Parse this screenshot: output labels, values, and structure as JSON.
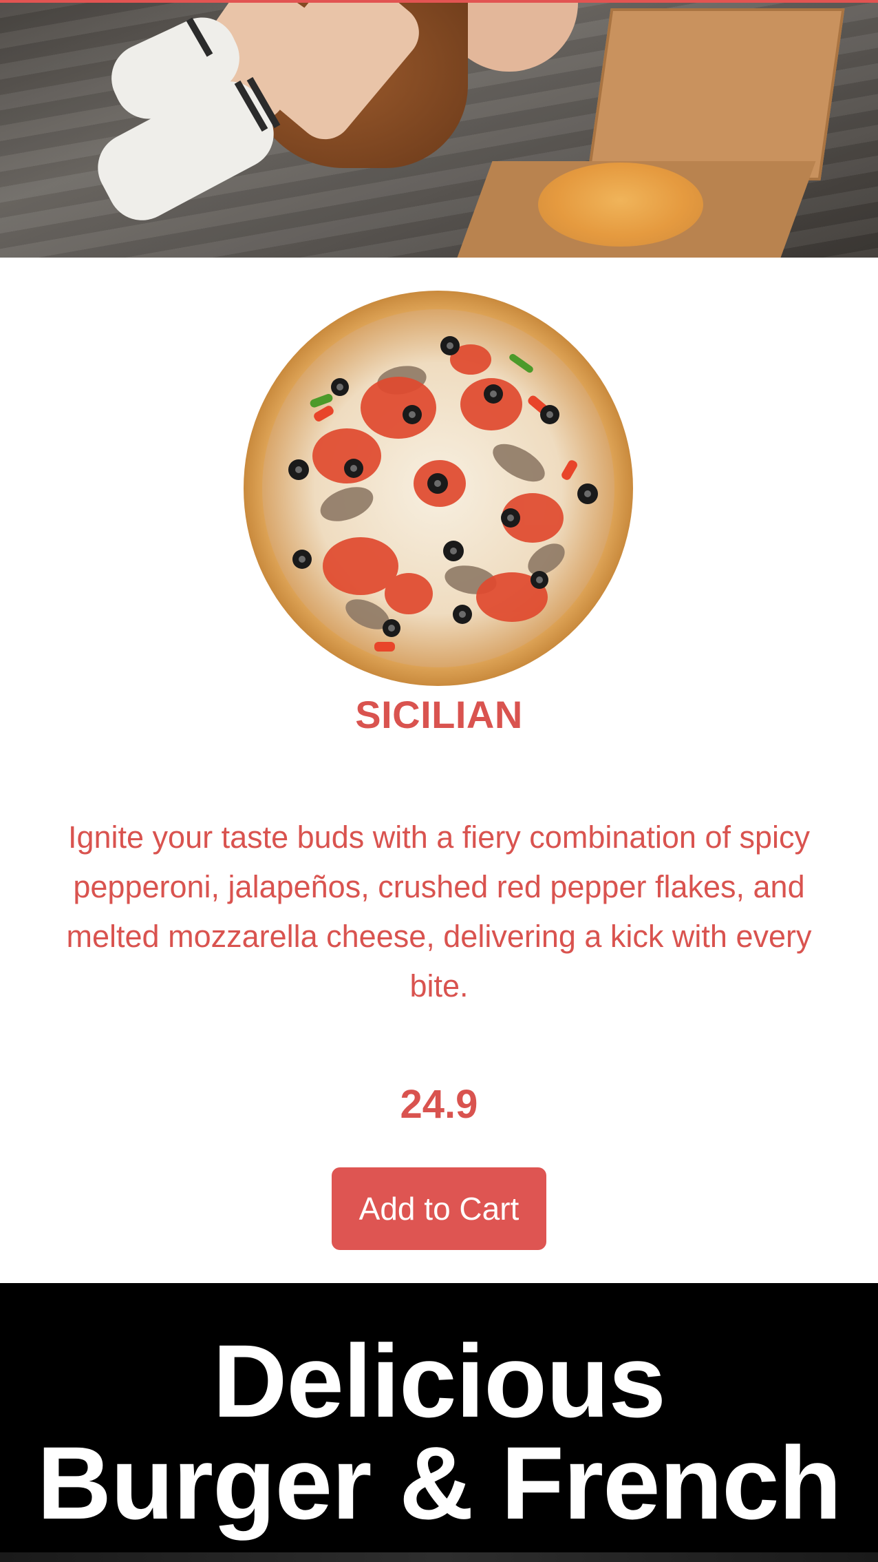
{
  "product": {
    "name": "SICILIAN",
    "description": "Ignite your taste buds with a fiery combination of spicy pepperoni, jalapeños, crushed red pepper flakes, and melted mozzarella cheese, delivering a kick with every bite.",
    "price": "24.9",
    "add_to_cart_label": "Add to Cart"
  },
  "banner": {
    "line1": "Delicious",
    "line2": "Burger & French"
  },
  "colors": {
    "accent": "#d9534f",
    "button": "#de5552",
    "banner_bg": "#000000"
  }
}
